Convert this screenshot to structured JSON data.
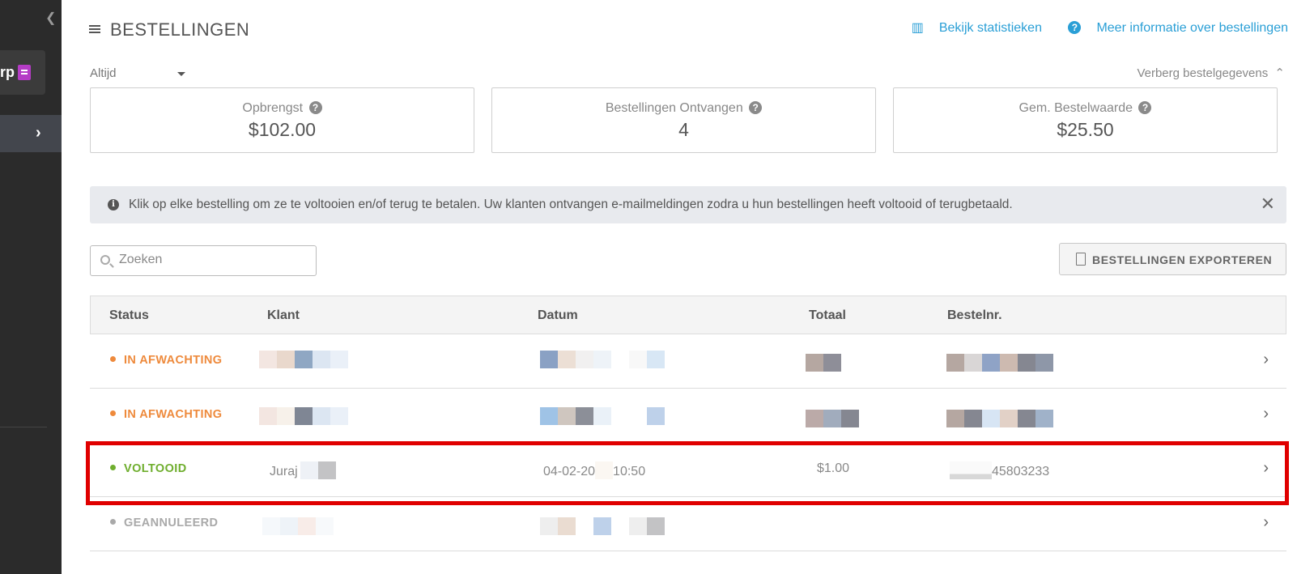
{
  "sidebar": {
    "collapse_icon": "chevron-left-icon",
    "item1_label": "rp",
    "item2_icon": "chevron-right-icon"
  },
  "page": {
    "title": "BESTELLINGEN",
    "stats_link": "Bekijk statistieken",
    "info_link": "Meer informatie over bestellingen"
  },
  "filters": {
    "period": "Altijd",
    "hide_details": "Verberg bestelgegevens"
  },
  "stats": [
    {
      "label": "Opbrengst",
      "value": "$102.00"
    },
    {
      "label": "Bestellingen Ontvangen",
      "value": "4"
    },
    {
      "label": "Gem. Bestelwaarde",
      "value": "$25.50"
    }
  ],
  "notice": {
    "text": "Klik op elke bestelling om ze te voltooien en/of terug te betalen. Uw klanten ontvangen e-mailmeldingen zodra u hun bestellingen heeft voltooid of terugbetaald."
  },
  "search": {
    "placeholder": "Zoeken"
  },
  "export_label": "BESTELLINGEN EXPORTEREN",
  "table": {
    "headers": {
      "status": "Status",
      "customer": "Klant",
      "date": "Datum",
      "total": "Totaal",
      "order_nr": "Bestelnr."
    },
    "rows": [
      {
        "status": "IN AFWACHTING",
        "customer": "",
        "date": "",
        "total": "",
        "order_nr": ""
      },
      {
        "status": "IN AFWACHTING",
        "customer": "",
        "date": "",
        "total": "",
        "order_nr": ""
      },
      {
        "status": "VOLTOOID",
        "customer": "Juraj",
        "date_part1": "04-02-20",
        "date_part2": "10:50",
        "total": "$1.00",
        "order_nr": "45803233"
      },
      {
        "status": "GEANNULEERD",
        "customer": "",
        "date": "",
        "total": "",
        "order_nr": ""
      }
    ]
  },
  "colors": {
    "pending": "#ee8a3c",
    "completed": "#6fae2e",
    "cancelled": "#a9a9a9",
    "link": "#2a9fd6",
    "highlight": "#e00000"
  }
}
